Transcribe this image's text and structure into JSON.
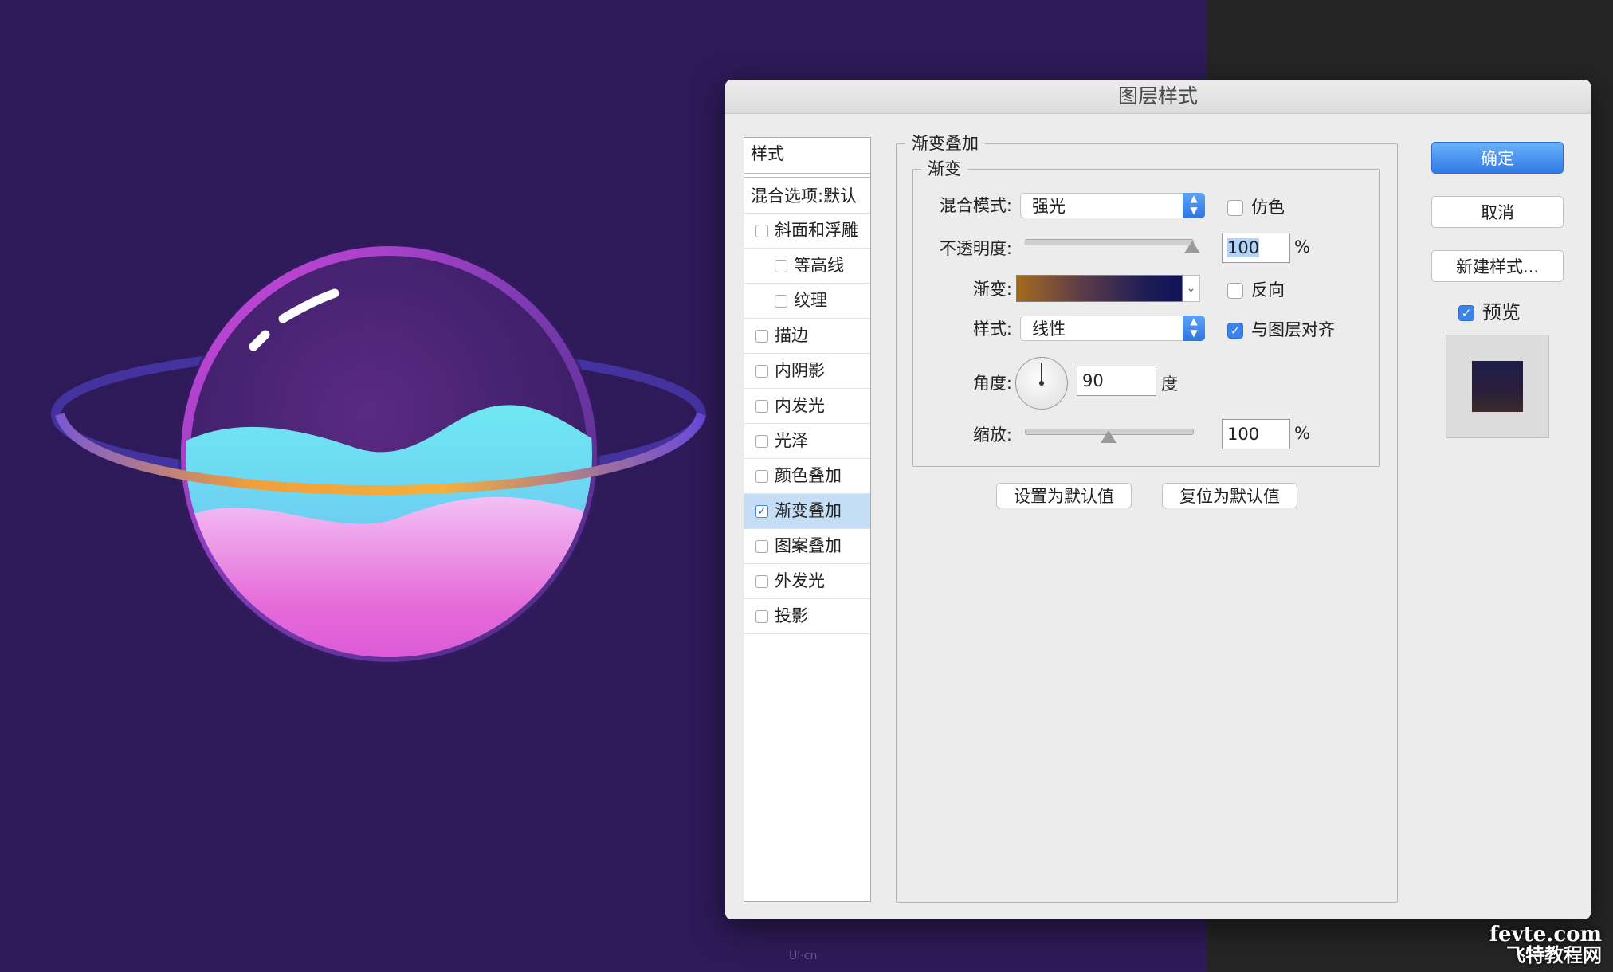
{
  "dialog": {
    "title": "图层样式",
    "styles_header": "样式",
    "blend_options": "混合选项:默认",
    "style_items": [
      {
        "label": "斜面和浮雕",
        "checked": false,
        "indent": false
      },
      {
        "label": "等高线",
        "checked": false,
        "indent": true
      },
      {
        "label": "纹理",
        "checked": false,
        "indent": true
      },
      {
        "label": "描边",
        "checked": false,
        "indent": false
      },
      {
        "label": "内阴影",
        "checked": false,
        "indent": false
      },
      {
        "label": "内发光",
        "checked": false,
        "indent": false
      },
      {
        "label": "光泽",
        "checked": false,
        "indent": false
      },
      {
        "label": "颜色叠加",
        "checked": false,
        "indent": false
      },
      {
        "label": "渐变叠加",
        "checked": true,
        "indent": false
      },
      {
        "label": "图案叠加",
        "checked": false,
        "indent": false
      },
      {
        "label": "外发光",
        "checked": false,
        "indent": false
      },
      {
        "label": "投影",
        "checked": false,
        "indent": false
      }
    ],
    "section_title": "渐变叠加",
    "subsection_title": "渐变",
    "blend_mode_label": "混合模式:",
    "blend_mode_value": "强光",
    "dither_label": "仿色",
    "dither_checked": false,
    "opacity_label": "不透明度:",
    "opacity_value": "100",
    "opacity_unit": "%",
    "opacity_fraction": 1.0,
    "gradient_label": "渐变:",
    "gradient_colors": [
      "#a46a1f",
      "#10125a"
    ],
    "reverse_label": "反向",
    "reverse_checked": false,
    "style_label": "样式:",
    "style_value": "线性",
    "align_label": "与图层对齐",
    "align_checked": true,
    "angle_label": "角度:",
    "angle_value": "90",
    "angle_unit": "度",
    "scale_label": "缩放:",
    "scale_value": "100",
    "scale_unit": "%",
    "scale_fraction": 0.5,
    "set_default_button": "设置为默认值",
    "reset_default_button": "复位为默认值",
    "ok_button": "确定",
    "cancel_button": "取消",
    "new_style_button": "新建样式...",
    "preview_label": "预览",
    "preview_checked": true
  },
  "watermark": {
    "line1": "fevte.com",
    "line2": "飞特教程网"
  },
  "canvas_mark": "UI·cn",
  "colors": {
    "canvas_background": "#2e1a58",
    "accent": "#2f7ae6"
  }
}
